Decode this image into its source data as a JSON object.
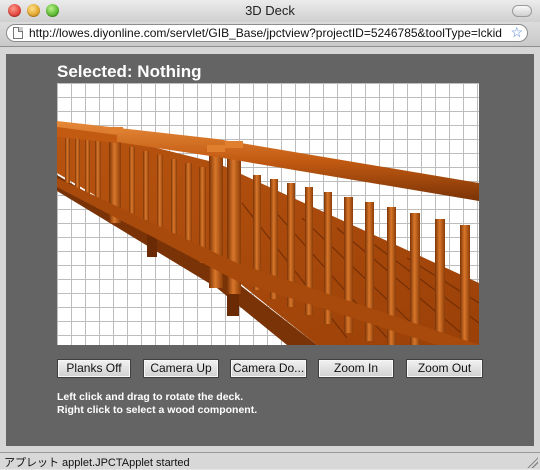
{
  "window": {
    "title": "3D Deck",
    "url": "http://lowes.diyonline.com/servlet/GIB_Base/jpctview?projectID=5246785&toolType=lckid",
    "status": "アプレット applet.JPCTApplet started"
  },
  "applet": {
    "selected": "Selected: Nothing",
    "buttons": [
      {
        "label": "Planks Off"
      },
      {
        "label": "Camera Up"
      },
      {
        "label": "Camera Do..."
      },
      {
        "label": "Zoom In"
      },
      {
        "label": "Zoom Out"
      }
    ],
    "help": [
      "Left click and drag to rotate the deck.",
      "Right click to select a wood component."
    ]
  },
  "colors": {
    "applet_bg": "#646464",
    "wood": "#c25a12",
    "wood_dark": "#7a3306",
    "wood_light": "#e0802e"
  },
  "icons": [
    "close-icon",
    "minimize-icon",
    "zoom-icon",
    "page-icon",
    "bookmark-star-icon",
    "resize-grip-icon"
  ]
}
